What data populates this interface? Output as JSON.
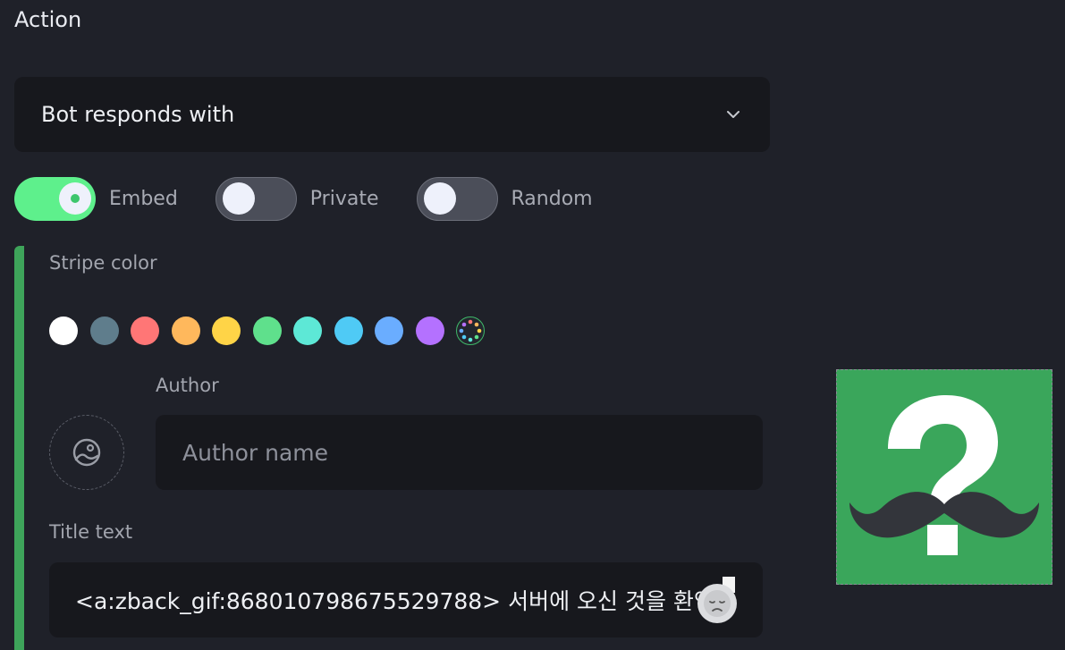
{
  "section": {
    "title": "Action"
  },
  "dropdown": {
    "selected": "Bot responds with"
  },
  "toggles": [
    {
      "label": "Embed",
      "state": "on"
    },
    {
      "label": "Private",
      "state": "off"
    },
    {
      "label": "Random",
      "state": "off"
    }
  ],
  "stripe": {
    "label": "Stripe color",
    "color": "#3ea45a",
    "swatches": [
      "#ffffff",
      "#5f7d8c",
      "#ff7676",
      "#ffb85c",
      "#ffd447",
      "#5fe08c",
      "#5de8d6",
      "#4fcaf5",
      "#6aadff",
      "#b471ff"
    ]
  },
  "author": {
    "label": "Author",
    "placeholder": "Author name"
  },
  "title": {
    "label": "Title text",
    "value": "<a:zback_gif:868010798675529788> 서버에 오신 것을 환영"
  },
  "colors": {
    "background": "#1f2129",
    "panel": "#17181d",
    "accent": "#5ef08c"
  }
}
